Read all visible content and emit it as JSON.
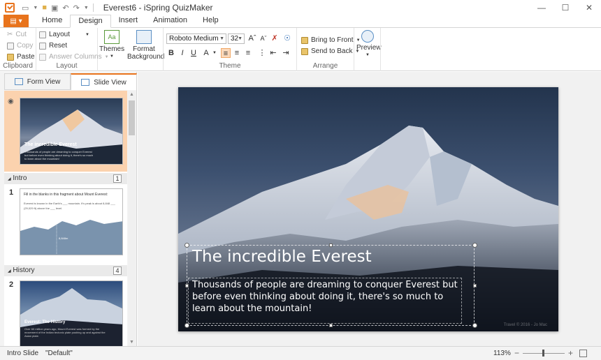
{
  "window": {
    "title": "Everest6 - iSpring QuizMaker"
  },
  "tabs": [
    "Home",
    "Design",
    "Insert",
    "Animation",
    "Help"
  ],
  "ribbon": {
    "clipboard": {
      "label": "Clipboard",
      "cut": "Cut",
      "copy": "Copy",
      "paste": "Paste"
    },
    "layout": {
      "label": "Layout",
      "layout": "Layout",
      "reset": "Reset",
      "answer_columns": "Answer Columns"
    },
    "themes": {
      "themes": "Themes",
      "format_background_1": "Format",
      "format_background_2": "Background"
    },
    "theme": {
      "label": "Theme",
      "font": "Roboto Medium",
      "size": "32"
    },
    "arrange": {
      "label": "Arrange",
      "bring_to_front": "Bring to Front",
      "send_to_back": "Send to Back"
    },
    "preview": {
      "label": "Preview"
    }
  },
  "left_panel": {
    "form_view": "Form View",
    "slide_view": "Slide View",
    "sections": [
      {
        "name": "Intro",
        "count": "1"
      },
      {
        "name": "History",
        "count": "4"
      }
    ],
    "slides": [
      {
        "number": "",
        "title": "The incredible Everest",
        "text": "Thousands of people are dreaming to conquer Everest but before even thinking about doing it, there's so much to learn about the mountain!"
      },
      {
        "number": "1",
        "title": "Fill in the blanks in this fragment about Mount Everest:",
        "text": "Everest is known in the Earth's ___ mountain. It's peak is about 8,848 ___ (29,029 ft) above the ___ level.",
        "chart_label": "8,848m"
      },
      {
        "number": "2",
        "title": "Everest: The History",
        "text": "Over 60 million years ago, Mount Everest was formed by the movement of the Indian tectonic plate pushing up and against the Asian plate."
      }
    ]
  },
  "slide": {
    "title": "The incredible Everest",
    "body": "Thousands of people are dreaming to conquer Everest but before even thinking about doing it, there's so much to learn about the mountain!",
    "copyright": "Travel © 2016 - Jo Mac"
  },
  "status": {
    "slide_name": "Intro Slide",
    "layout": "\"Default\"",
    "zoom": "113%"
  }
}
